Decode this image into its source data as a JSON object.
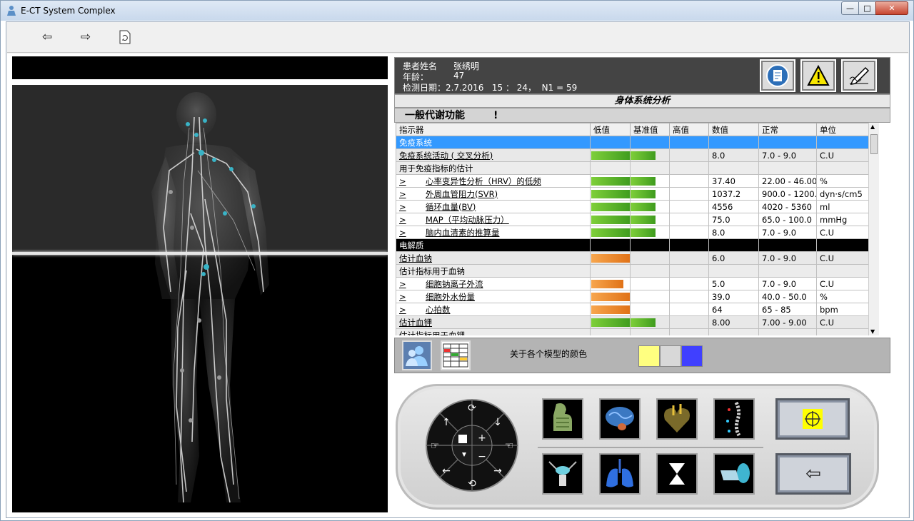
{
  "window": {
    "title": "E-CT System Complex"
  },
  "icons": {
    "back": "arrow-left-icon",
    "forward": "arrow-right-icon",
    "refresh": "refresh-document-icon"
  },
  "patient": {
    "name_label": "患者姓名",
    "name": "张绣明",
    "age_label": "年龄：",
    "age": "47",
    "date_line": "检测日期：2.7.2016   15 ： 24，  N1 = 59"
  },
  "section_title": "身体系统分析",
  "subsection_title": "一般代谢功能",
  "subsection_mark": "!",
  "table": {
    "headers": [
      "指示器",
      "低值",
      "基准值",
      "高值",
      "数值",
      "正常",
      "单位"
    ],
    "rows": [
      {
        "kind": "grp",
        "label": "免疫系统",
        "value": "",
        "normal": "",
        "unit": ""
      },
      {
        "kind": "main",
        "label": "免疫系统活动 ( 交叉分析)",
        "bar": "green",
        "bar_level": 0.55,
        "value": "8.0",
        "normal": "7.0 - 9.0",
        "unit": "C.U"
      },
      {
        "kind": "sub",
        "label": "用于免疫指标的估计",
        "value": "",
        "normal": "",
        "unit": ""
      },
      {
        "kind": "det",
        "prefix": ">",
        "label": "心率变异性分析（HRV）的低频",
        "bar": "green",
        "bar_level": 0.55,
        "value": "37.40",
        "normal": "22.00 - 46.00",
        "unit": "%"
      },
      {
        "kind": "det",
        "prefix": ">",
        "label": "外周血管阻力(SVR)",
        "bar": "green",
        "bar_level": 0.55,
        "value": "1037.2",
        "normal": "900.0 - 1200.",
        "unit": "dyn·s/cm5"
      },
      {
        "kind": "det",
        "prefix": ">",
        "label": "循环血量(BV)",
        "bar": "green",
        "bar_level": 0.55,
        "value": "4556",
        "normal": "4020 - 5360",
        "unit": "ml"
      },
      {
        "kind": "det",
        "prefix": ">",
        "label": "MAP（平均动脉压力）",
        "bar": "green",
        "bar_level": 0.55,
        "value": "75.0",
        "normal": "65.0 - 100.0",
        "unit": "mmHg"
      },
      {
        "kind": "det",
        "prefix": ">",
        "label": "脑内血清素的推算量",
        "bar": "green",
        "bar_level": 0.55,
        "value": "8.0",
        "normal": "7.0 - 9.0",
        "unit": "C.U"
      },
      {
        "kind": "grp2",
        "label": "电解质",
        "value": "",
        "normal": "",
        "unit": ""
      },
      {
        "kind": "main",
        "label": "估计血钠",
        "bar": "orange",
        "bar_level": 0.33,
        "value": "6.0",
        "normal": "7.0 - 9.0",
        "unit": "C.U"
      },
      {
        "kind": "sub",
        "label": "估计指标用于血钠",
        "value": "",
        "normal": "",
        "unit": ""
      },
      {
        "kind": "det",
        "prefix": ">",
        "label": "细胞钠离子外流",
        "bar": "orange",
        "bar_level": 0.28,
        "value": "5.0",
        "normal": "7.0 - 9.0",
        "unit": "C.U"
      },
      {
        "kind": "det",
        "prefix": ">",
        "label": "细胞外水份量",
        "bar": "orange",
        "bar_level": 0.33,
        "value": "39.0",
        "normal": "40.0 - 50.0",
        "unit": "%"
      },
      {
        "kind": "det",
        "prefix": ">",
        "label": "心拍数",
        "bar": "orange",
        "bar_level": 0.33,
        "value": "64",
        "normal": "65 - 85",
        "unit": "bpm"
      },
      {
        "kind": "main",
        "label": "估计血钾",
        "bar": "green",
        "bar_level": 0.55,
        "value": "8.00",
        "normal": "7.00 - 9.00",
        "unit": "C.U"
      },
      {
        "kind": "sub",
        "label": "估计指标用于血钾",
        "value": "",
        "normal": "",
        "unit": ""
      }
    ]
  },
  "legend": {
    "label": "关于各个模型的颜色",
    "colors": [
      "#ffff80",
      "#d8d8d8",
      "#4040ff"
    ]
  },
  "colors": {
    "accent": "#3399ff",
    "bar_green": "#5cb82a",
    "bar_orange": "#ef8b2c",
    "panel_dark": "#444444"
  }
}
